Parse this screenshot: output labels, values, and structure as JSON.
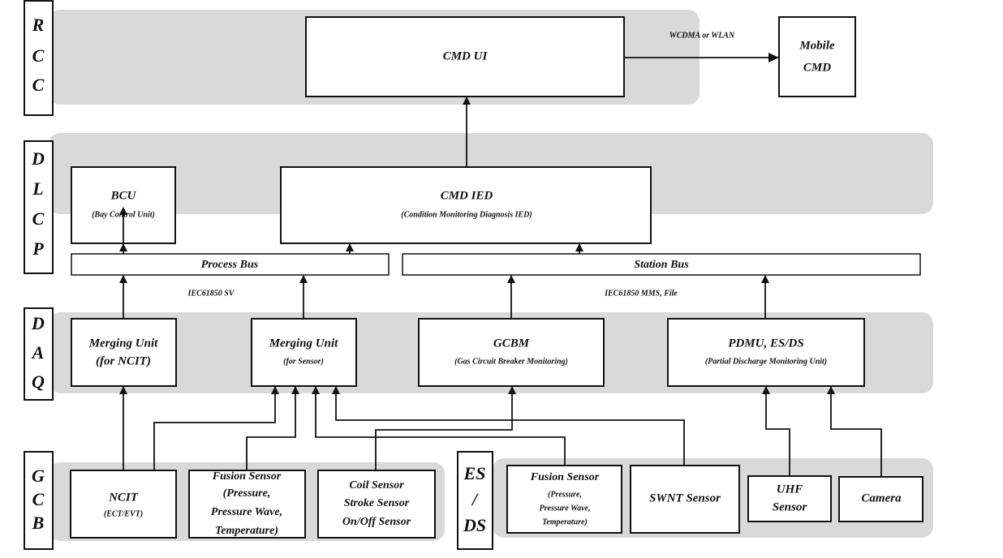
{
  "layers": {
    "rcc": [
      "R",
      "C",
      "C"
    ],
    "dlcp": [
      "D",
      "L",
      "C",
      "P"
    ],
    "daq": [
      "D",
      "A",
      "Q"
    ],
    "gcb": [
      "G",
      "C",
      "B"
    ],
    "esds": [
      "ES",
      "/",
      "DS"
    ]
  },
  "rcc": {
    "cmd_ui": "CMD UI",
    "mobile_cmd": [
      "Mobile",
      "CMD"
    ],
    "link_label": "WCDMA or WLAN"
  },
  "dlcp": {
    "bcu": {
      "title": "BCU",
      "subtitle": "(Bay Control Unit)"
    },
    "cmd_ied": {
      "title": "CMD IED",
      "subtitle": "(Condition Monitoring Diagnosis IED)"
    }
  },
  "buses": {
    "process_bus": "Process Bus",
    "station_bus": "Station Bus",
    "process_protocol": "IEC61850 SV",
    "station_protocol": "IEC61850 MMS, File"
  },
  "daq": {
    "mu_ncit": [
      "Merging Unit",
      "(for NCIT)"
    ],
    "mu_sensor": {
      "title": "Merging Unit",
      "subtitle": "(for Sensor)"
    },
    "gcbm": {
      "title": "GCBM",
      "subtitle": "(Gas Circuit Breaker Monitoring)"
    },
    "pdmu": {
      "title": "PDMU, ES/DS",
      "subtitle": "(Partial Discharge Monitoring Unit)"
    }
  },
  "gcb": {
    "ncit": {
      "title": "NCIT",
      "subtitle": "(ECT/EVT)"
    },
    "fusion": [
      "Fusion Sensor",
      "(Pressure,",
      "Pressure Wave,",
      "Temperature)"
    ],
    "coil": [
      "Coil Sensor",
      "Stroke Sensor",
      "On/Off Sensor"
    ]
  },
  "esds": {
    "fusion": {
      "title": "Fusion Sensor",
      "lines": [
        "(Pressure,",
        "Pressure Wave,",
        "Temperature)"
      ]
    },
    "swnt": "SWNT Sensor",
    "uhf": [
      "UHF",
      "Sensor"
    ],
    "camera": "Camera"
  }
}
